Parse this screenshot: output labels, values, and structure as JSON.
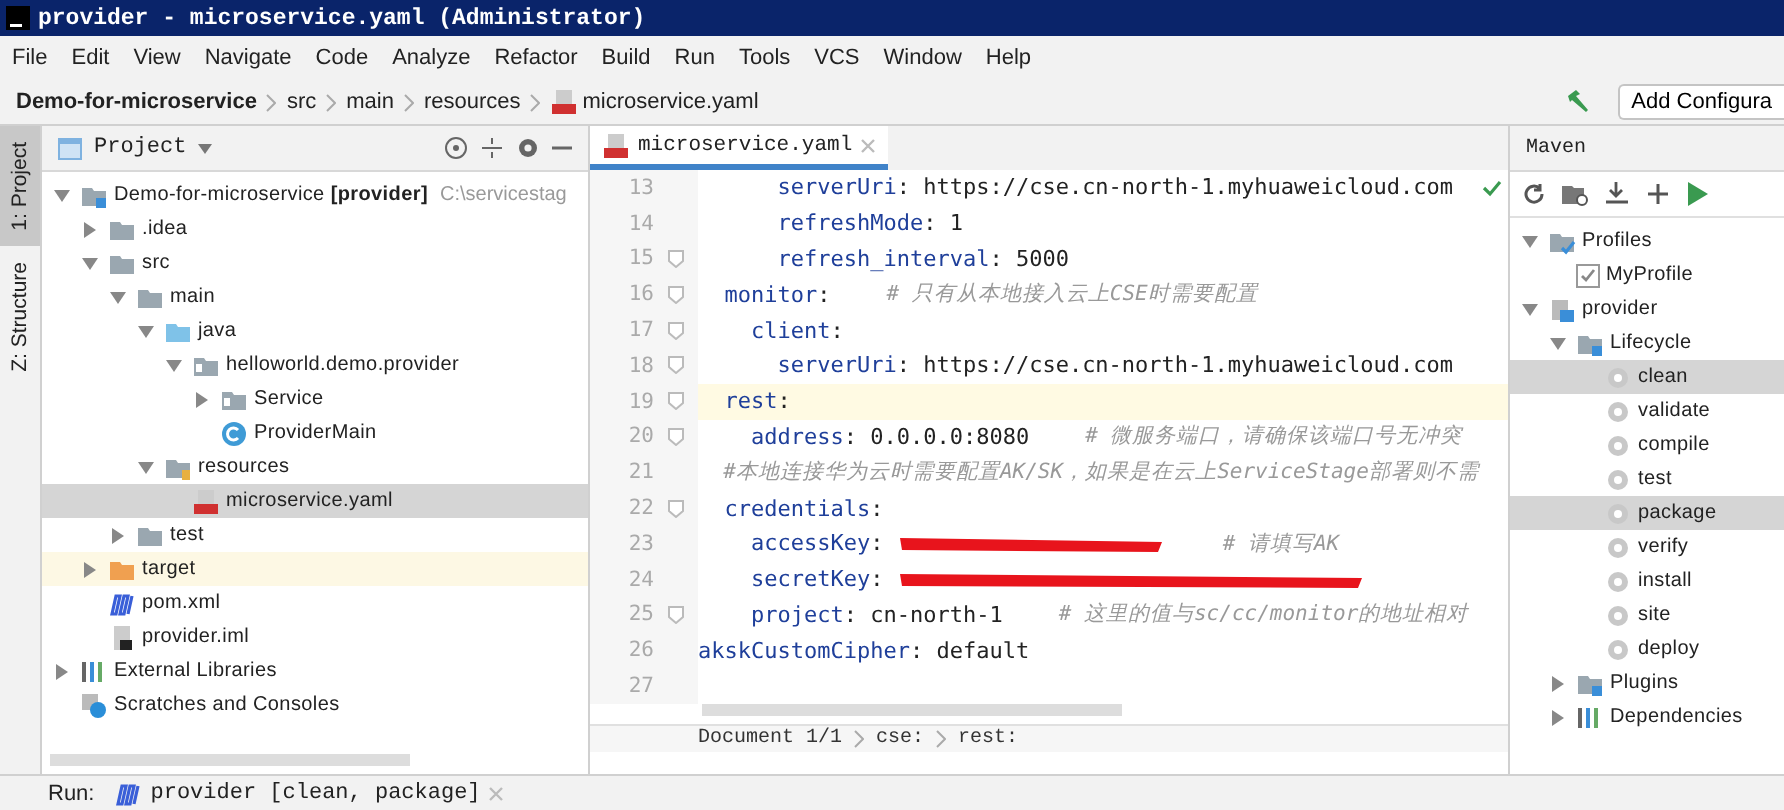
{
  "window": {
    "title": "provider - microservice.yaml (Administrator)"
  },
  "menu": [
    "File",
    "Edit",
    "View",
    "Navigate",
    "Code",
    "Analyze",
    "Refactor",
    "Build",
    "Run",
    "Tools",
    "VCS",
    "Window",
    "Help"
  ],
  "breadcrumb": [
    {
      "label": "Demo-for-microservice",
      "kind": "project"
    },
    {
      "label": "src",
      "kind": "folder"
    },
    {
      "label": "main",
      "kind": "folder"
    },
    {
      "label": "resources",
      "kind": "folder"
    },
    {
      "label": "microservice.yaml",
      "kind": "yaml"
    }
  ],
  "run_config": {
    "label": "Add Configura"
  },
  "side_tabs": [
    {
      "label": "1: Project",
      "selected": true
    },
    {
      "label": "Z: Structure",
      "selected": false
    }
  ],
  "project": {
    "title": "Project",
    "tree": [
      {
        "label": "Demo-for-microservice **[provider]**",
        "path": "C:\\servicestag",
        "kind": "module",
        "expanded": true,
        "selected": false,
        "children": [
          {
            "label": ".idea",
            "kind": "folder",
            "expanded": false,
            "selected": false
          },
          {
            "label": "src",
            "kind": "folder",
            "expanded": true,
            "selected": false,
            "children": [
              {
                "label": "main",
                "kind": "folder",
                "expanded": true,
                "selected": false,
                "children": [
                  {
                    "label": "java",
                    "kind": "source",
                    "expanded": true,
                    "selected": false,
                    "children": [
                      {
                        "label": "helloworld.demo.provider",
                        "kind": "package",
                        "expanded": true,
                        "selected": false,
                        "children": [
                          {
                            "label": "Service",
                            "kind": "package",
                            "expanded": false,
                            "selected": false
                          },
                          {
                            "label": "ProviderMain",
                            "kind": "class",
                            "selected": false
                          }
                        ]
                      }
                    ]
                  },
                  {
                    "label": "resources",
                    "kind": "resources",
                    "expanded": true,
                    "selected": false,
                    "children": [
                      {
                        "label": "microservice.yaml",
                        "kind": "yaml",
                        "selected": true
                      }
                    ]
                  }
                ]
              },
              {
                "label": "test",
                "kind": "folder",
                "expanded": false,
                "selected": false
              }
            ]
          },
          {
            "label": "target",
            "kind": "excluded",
            "expanded": false,
            "selected": false
          },
          {
            "label": "pom.xml",
            "kind": "maven",
            "selected": false
          },
          {
            "label": "provider.iml",
            "kind": "iml",
            "selected": false
          }
        ]
      },
      {
        "label": "External Libraries",
        "kind": "libraries",
        "expanded": false,
        "selected": false
      },
      {
        "label": "Scratches and Consoles",
        "kind": "scratches",
        "selected": false
      }
    ]
  },
  "editor": {
    "tab": "microservice.yaml",
    "lines": [
      {
        "no": "13",
        "fold": false,
        "current": false,
        "check": true,
        "tokens": [
          {
            "kind": "key",
            "text": "      serverUri"
          },
          {
            "kind": "punct",
            "text": ": "
          },
          {
            "kind": "value",
            "text": "https://cse.cn-north-1.myhuaweicloud.com"
          }
        ]
      },
      {
        "no": "14",
        "fold": false,
        "current": false,
        "check": false,
        "tokens": [
          {
            "kind": "key",
            "text": "      refreshMode"
          },
          {
            "kind": "punct",
            "text": ": "
          },
          {
            "kind": "value",
            "text": "1"
          }
        ]
      },
      {
        "no": "15",
        "fold": true,
        "current": false,
        "check": false,
        "tokens": [
          {
            "kind": "key",
            "text": "      refresh_interval"
          },
          {
            "kind": "punct",
            "text": ": "
          },
          {
            "kind": "value",
            "text": "5000"
          }
        ]
      },
      {
        "no": "16",
        "fold": true,
        "current": false,
        "check": false,
        "tokens": [
          {
            "kind": "key",
            "text": "  monitor"
          },
          {
            "kind": "punct",
            "text": ":"
          },
          {
            "kind": "comment",
            "text": "# 只有从本地接入云上CSE时需要配置"
          }
        ]
      },
      {
        "no": "17",
        "fold": true,
        "current": false,
        "check": false,
        "tokens": [
          {
            "kind": "key",
            "text": "    client"
          },
          {
            "kind": "punct",
            "text": ":"
          }
        ]
      },
      {
        "no": "18",
        "fold": true,
        "current": false,
        "check": false,
        "tokens": [
          {
            "kind": "key",
            "text": "      serverUri"
          },
          {
            "kind": "punct",
            "text": ": "
          },
          {
            "kind": "value",
            "text": "https://cse.cn-north-1.myhuaweicloud.com"
          }
        ]
      },
      {
        "no": "19",
        "fold": true,
        "current": true,
        "check": false,
        "tokens": [
          {
            "kind": "key",
            "text": "  rest"
          },
          {
            "kind": "punct",
            "text": ":"
          }
        ]
      },
      {
        "no": "20",
        "fold": true,
        "current": false,
        "check": false,
        "tokens": [
          {
            "kind": "key",
            "text": "    address"
          },
          {
            "kind": "punct",
            "text": ": "
          },
          {
            "kind": "value",
            "text": "0.0.0.0:8080"
          },
          {
            "kind": "comment",
            "text": "# 微服务端口，请确保该端口号无冲突"
          }
        ]
      },
      {
        "no": "21",
        "fold": false,
        "current": false,
        "check": false,
        "tokens": [
          {
            "kind": "comment",
            "text": "  #本地连接华为云时需要配置AK/SK，如果是在云上ServiceStage部署则不需"
          }
        ]
      },
      {
        "no": "22",
        "fold": true,
        "current": false,
        "check": false,
        "tokens": [
          {
            "kind": "key",
            "text": "  credentials"
          },
          {
            "kind": "punct",
            "text": ":"
          }
        ]
      },
      {
        "no": "23",
        "fold": false,
        "current": false,
        "check": false,
        "tokens": [
          {
            "kind": "key",
            "text": "    accessKey"
          },
          {
            "kind": "punct",
            "text": ": "
          },
          {
            "kind": "redacted"
          },
          {
            "kind": "comment",
            "text": "# 请填写AK"
          }
        ]
      },
      {
        "no": "24",
        "fold": false,
        "current": false,
        "check": false,
        "tokens": [
          {
            "kind": "key",
            "text": "    secretKey"
          },
          {
            "kind": "punct",
            "text": ": "
          },
          {
            "kind": "redacted"
          }
        ]
      },
      {
        "no": "25",
        "fold": true,
        "current": false,
        "check": false,
        "tokens": [
          {
            "kind": "key",
            "text": "    project"
          },
          {
            "kind": "punct",
            "text": ": "
          },
          {
            "kind": "value",
            "text": "cn-north-1"
          },
          {
            "kind": "comment",
            "text": "# 这里的值与sc/cc/monitor的地址相对"
          }
        ]
      },
      {
        "no": "26",
        "fold": false,
        "current": false,
        "check": false,
        "tokens": [
          {
            "kind": "key",
            "text": "akskCustomCipher"
          },
          {
            "kind": "punct",
            "text": ": "
          },
          {
            "kind": "value",
            "text": "default"
          }
        ]
      },
      {
        "no": "27",
        "fold": false,
        "current": false,
        "check": false
      }
    ],
    "path": [
      "Document 1/1",
      "cse:",
      "rest:"
    ]
  },
  "maven": {
    "title": "Maven",
    "tree": [
      {
        "label": "Profiles",
        "kind": "profiles",
        "expanded": true,
        "selected": false,
        "children": [
          {
            "label": "MyProfile",
            "kind": "checkbox",
            "checked": true,
            "selected": false
          }
        ]
      },
      {
        "label": "provider",
        "kind": "maven-module",
        "expanded": true,
        "selected": false,
        "children": [
          {
            "label": "Lifecycle",
            "kind": "lifecycle",
            "expanded": true,
            "selected": false,
            "children": [
              {
                "label": "clean",
                "kind": "goal",
                "selected": true
              },
              {
                "label": "validate",
                "kind": "goal",
                "selected": false
              },
              {
                "label": "compile",
                "kind": "goal",
                "selected": false
              },
              {
                "label": "test",
                "kind": "goal",
                "selected": false
              },
              {
                "label": "package",
                "kind": "goal",
                "selected": true
              },
              {
                "label": "verify",
                "kind": "goal",
                "selected": false
              },
              {
                "label": "install",
                "kind": "goal",
                "selected": false
              },
              {
                "label": "site",
                "kind": "goal",
                "selected": false
              },
              {
                "label": "deploy",
                "kind": "goal",
                "selected": false
              }
            ]
          },
          {
            "label": "Plugins",
            "kind": "lifecycle",
            "expanded": false,
            "selected": false
          },
          {
            "label": "Dependencies",
            "kind": "libraries",
            "expanded": false,
            "selected": false
          }
        ]
      }
    ]
  },
  "run_bar": {
    "label": "Run:",
    "tab": "provider [clean, package]"
  }
}
